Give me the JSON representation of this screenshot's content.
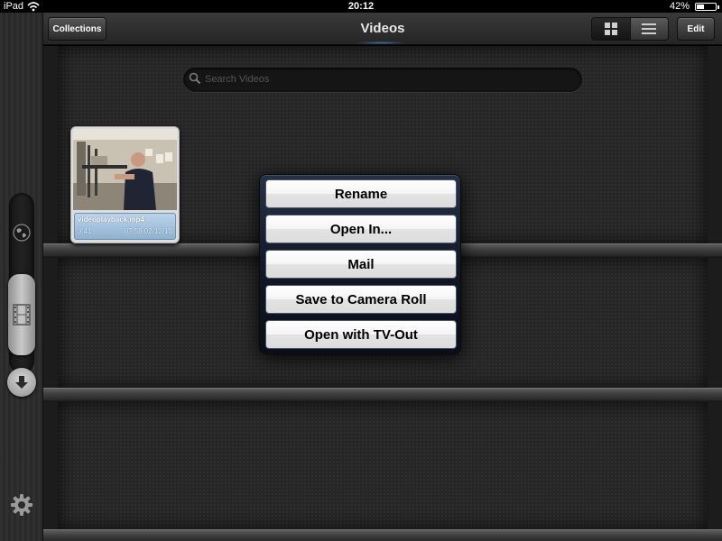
{
  "status_bar": {
    "carrier": "iPad",
    "time": "20:12",
    "battery_percent": "42%",
    "battery_level": 0.42
  },
  "nav": {
    "collections_label": "Collections",
    "title": "Videos",
    "edit_label": "Edit",
    "view_mode_selected": "list"
  },
  "search": {
    "placeholder": "Search Videos",
    "value": ""
  },
  "videos": [
    {
      "filename": "videoplayback.mp4",
      "duration": "3:41",
      "date": "07:58 02/12/13"
    }
  ],
  "action_menu": {
    "items": [
      "Rename",
      "Open In...",
      "Mail",
      "Save to Camera Roll",
      "Open with TV-Out"
    ]
  },
  "sidebar": {
    "icons": [
      "globe-icon",
      "film-icon",
      "download-icon",
      "gear-icon"
    ],
    "selected": "film-icon"
  },
  "colors": {
    "menu_background": "#0f1624",
    "caption_blue": "#8fb2d2",
    "shelf": "#262626"
  }
}
